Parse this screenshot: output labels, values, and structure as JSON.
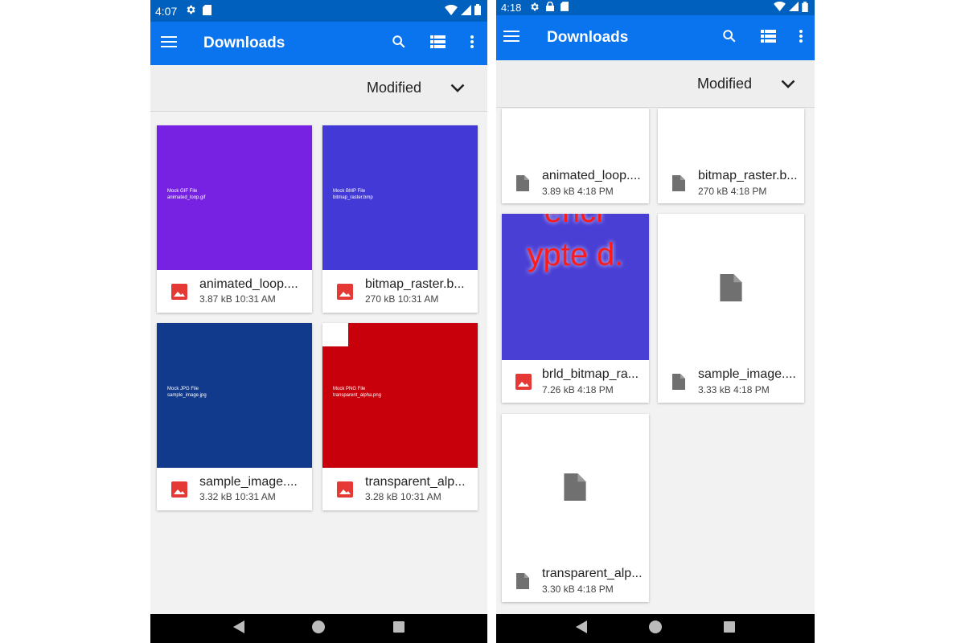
{
  "left": {
    "status": {
      "time": "4:07"
    },
    "appbar": {
      "title": "Downloads"
    },
    "sort": {
      "label": "Modified"
    },
    "files": [
      {
        "name": "animated_loop....",
        "meta": "3.87 kB 10:31 AM",
        "thumb_color": "#7722e3",
        "mock_line1": "Mock GIF File",
        "mock_line2": "animated_loop.gif"
      },
      {
        "name": "bitmap_raster.b...",
        "meta": "270 kB 10:31 AM",
        "thumb_color": "#4339d6",
        "mock_line1": "Mock BMP File",
        "mock_line2": "bitmap_raster.bmp"
      },
      {
        "name": "sample_image....",
        "meta": "3.32 kB 10:31 AM",
        "thumb_color": "#113a8c",
        "mock_line1": "Mock JPG File",
        "mock_line2": "sample_image.jpg"
      },
      {
        "name": "transparent_alp...",
        "meta": "3.28 kB 10:31 AM",
        "thumb_color": "#c8000c",
        "mock_line1": "Mock PNG File",
        "mock_line2": "transparent_alpha.png"
      }
    ]
  },
  "right": {
    "status": {
      "time": "4:18"
    },
    "appbar": {
      "title": "Downloads"
    },
    "sort": {
      "label": "Modified"
    },
    "files": [
      {
        "name": "animated_loop....",
        "meta": "3.89 kB 4:18 PM"
      },
      {
        "name": "bitmap_raster.b...",
        "meta": "270 kB 4:18 PM"
      },
      {
        "name": "brld_bitmap_ra...",
        "meta": "7.26 kB 4:18 PM",
        "thumb_color": "#4a3fd4",
        "thumb_text": "encr ypte d."
      },
      {
        "name": "sample_image....",
        "meta": "3.33 kB 4:18 PM"
      },
      {
        "name": "transparent_alp...",
        "meta": "3.30 kB 4:18 PM"
      }
    ]
  },
  "colors": {
    "status_bar": "#0060bd",
    "app_bar": "#0a73ee",
    "image_icon": "#e53935",
    "doc_icon": "#707070"
  }
}
